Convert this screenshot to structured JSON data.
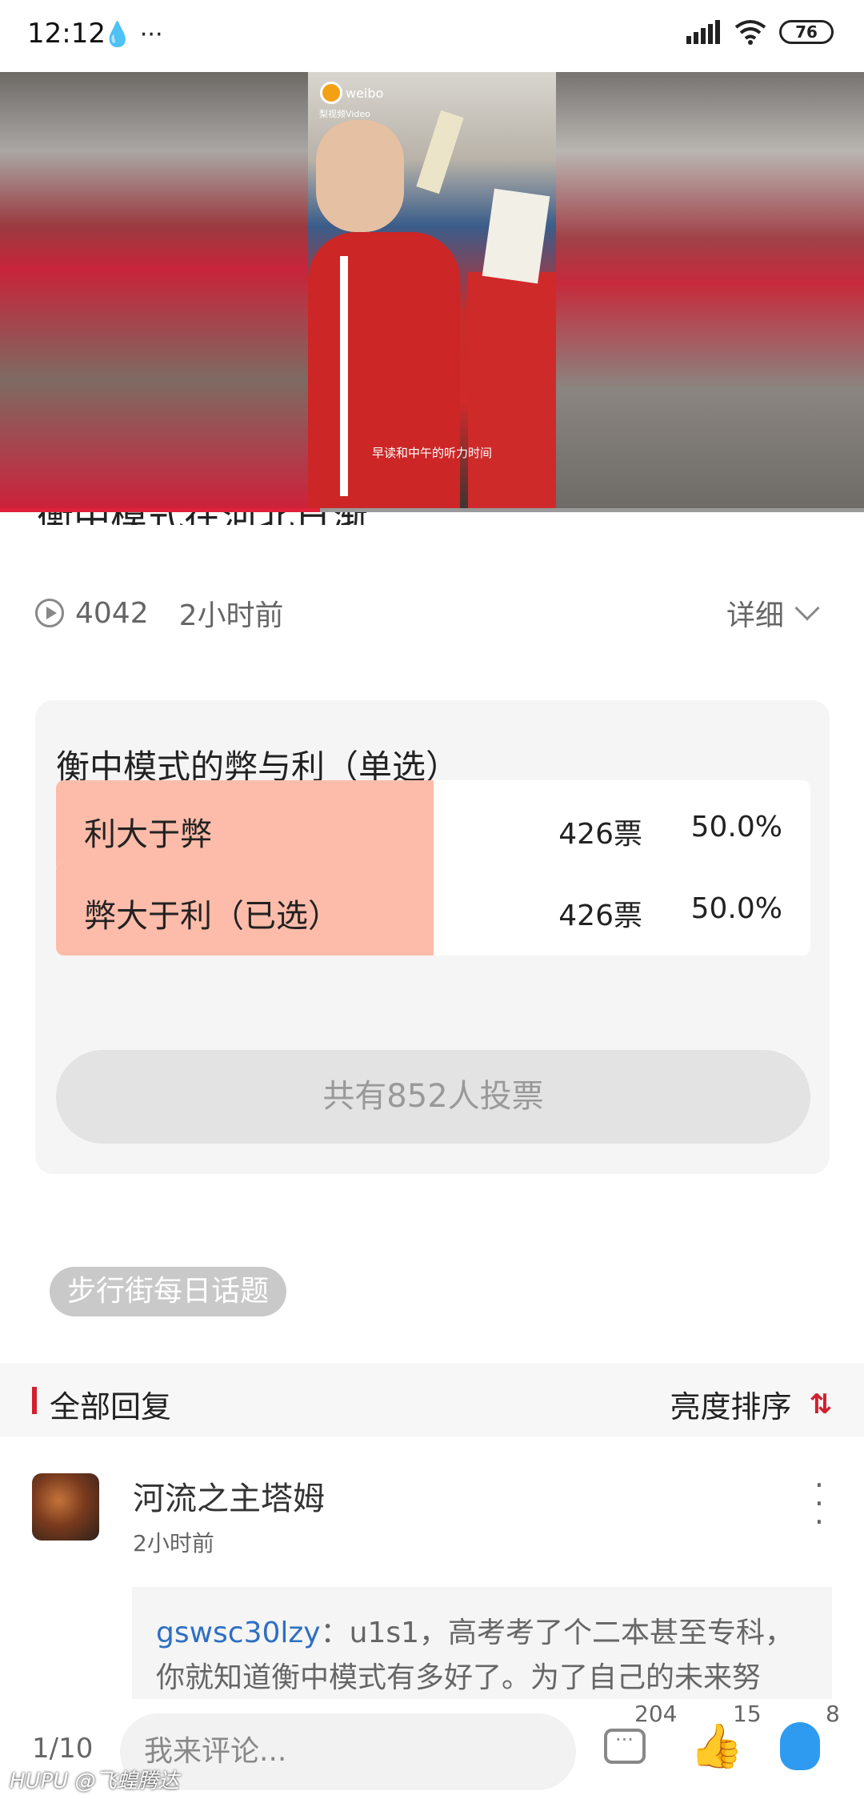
{
  "status_bar": {
    "time": "12:12",
    "left_icons": "💧 ···",
    "battery": "76"
  },
  "video": {
    "source_logo": "weibo",
    "source_sub": "梨视频Video",
    "subtitle": "早读和中午的听力时间",
    "progress_fraction": 0.37
  },
  "post": {
    "title_partial": "衡中模式在河北日渐",
    "views": "4042",
    "time_ago": "2小时前",
    "detail_label": "详细"
  },
  "poll": {
    "title": "衡中模式的弊与利（单选）",
    "options": [
      {
        "label": "利大于弊",
        "votes": "426票",
        "percent": "50.0%",
        "share": 0.5
      },
      {
        "label": "弊大于利（已选）",
        "votes": "426票",
        "percent": "50.0%",
        "share": 0.5
      }
    ],
    "total": "共有852人投票"
  },
  "topic_tag": "步行街每日话题",
  "replies": {
    "title": "全部回复",
    "sort_label": "亮度排序",
    "sort_icon": "sort-arrows-icon"
  },
  "comment": {
    "author": "河流之主塔姆",
    "time": "2小时前",
    "quote_user": "gswsc30lzy",
    "quote_text": "：u1s1，高考考了个二本甚至专科，你就知道衡中模式有多好了。为了自己的未来努"
  },
  "bottom_bar": {
    "page": "1/10",
    "input_placeholder": "我来评论...",
    "comments_count": "204",
    "likes_count": "15",
    "qq_count": "8"
  },
  "watermark": "HUPU @飞蝗腾达",
  "colors": {
    "accent_red": "#d0202f",
    "poll_fill": "#fdbcaa",
    "link_blue": "#2d6fc4"
  }
}
